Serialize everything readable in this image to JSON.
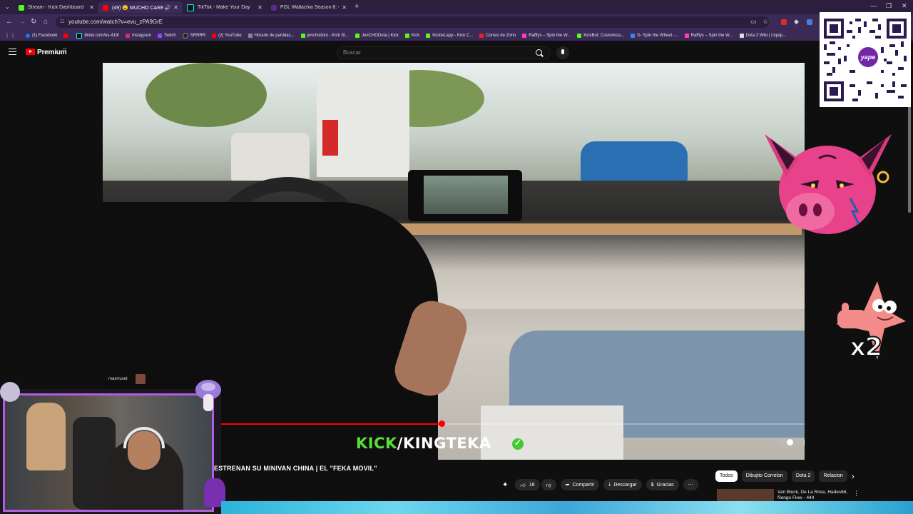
{
  "browser": {
    "tabs": [
      {
        "title": "Stream - Kick Dashboard",
        "icon": "kick-icon",
        "color": "#53fc18"
      },
      {
        "title": "(49) 😮 MUCHO CARRO PA...",
        "icon": "youtube-icon",
        "color": "#ff0000"
      },
      {
        "title": "TikTok - Make Your Day",
        "icon": "tiktok-icon",
        "color": "#000000"
      },
      {
        "title": "PGL Wallachia Season 8: Group",
        "icon": "pgl-icon",
        "color": "#5a2b8f"
      }
    ],
    "url": "youtube.com/watch?v=evu_zPA9GrE",
    "bookmarks": [
      {
        "label": "(1) Facebook",
        "color": "#1877f2"
      },
      {
        "label": "",
        "color": "#ff0000"
      },
      {
        "label": "tiktok.com/es-419/",
        "color": "#111111"
      },
      {
        "label": "Instagram",
        "color": "#d62976"
      },
      {
        "label": "Twitch",
        "color": "#9146ff"
      },
      {
        "label": "SRRRR",
        "color": "#222222"
      },
      {
        "label": "(2) YouTube",
        "color": "#ff0000"
      },
      {
        "label": "Horario de partidas...",
        "color": "#888888"
      },
      {
        "label": "jerichodoto - Kick St...",
        "color": "#53fc18"
      },
      {
        "label": "JeriCHODota | Kick",
        "color": "#53fc18"
      },
      {
        "label": "Kick",
        "color": "#53fc18"
      },
      {
        "label": "Kicklet.app - Kick C...",
        "color": "#53fc18"
      },
      {
        "label": "Correo de Zoho",
        "color": "#e42527"
      },
      {
        "label": "Rafflys – Spin the W...",
        "color": "#ff3db8"
      },
      {
        "label": "KickBot: Customiza...",
        "color": "#53fc18"
      },
      {
        "label": "D- Spin the Wheel -...",
        "color": "#3b82f6"
      },
      {
        "label": "Rafflys – Spin the W...",
        "color": "#ff3db8"
      },
      {
        "label": "Dota 2 Wiki | Liquip...",
        "color": "#dddddd"
      }
    ]
  },
  "youtube": {
    "brand": "Premium",
    "country": "PE",
    "search_placeholder": "Buscar",
    "progress_fraction": 0.483,
    "video_overlay": {
      "kick": "KICK",
      "slash": "/",
      "channel": "KINGTEKA"
    },
    "video_title": "ESTRENAN SU MINIVAN CHINA | EL \"FEKA MOVIL\"",
    "actions": {
      "likes": "18",
      "share": "Compartir",
      "download": "Descargar",
      "thanks": "Gracias"
    },
    "chips": [
      "Todos",
      "Dibujito Correlon",
      "Dota 2",
      "Relacion"
    ],
    "recommended": {
      "title": "Van Block, De La Rose, Hades66, Ñengo Flow - 444"
    }
  },
  "overlays": {
    "qr_badge": "yape",
    "multiplier": "x2",
    "chat_user": "maxrruset"
  },
  "colors": {
    "accent": "#ff0000",
    "kick_green": "#55e036",
    "cam_border": "#b05ee0"
  }
}
